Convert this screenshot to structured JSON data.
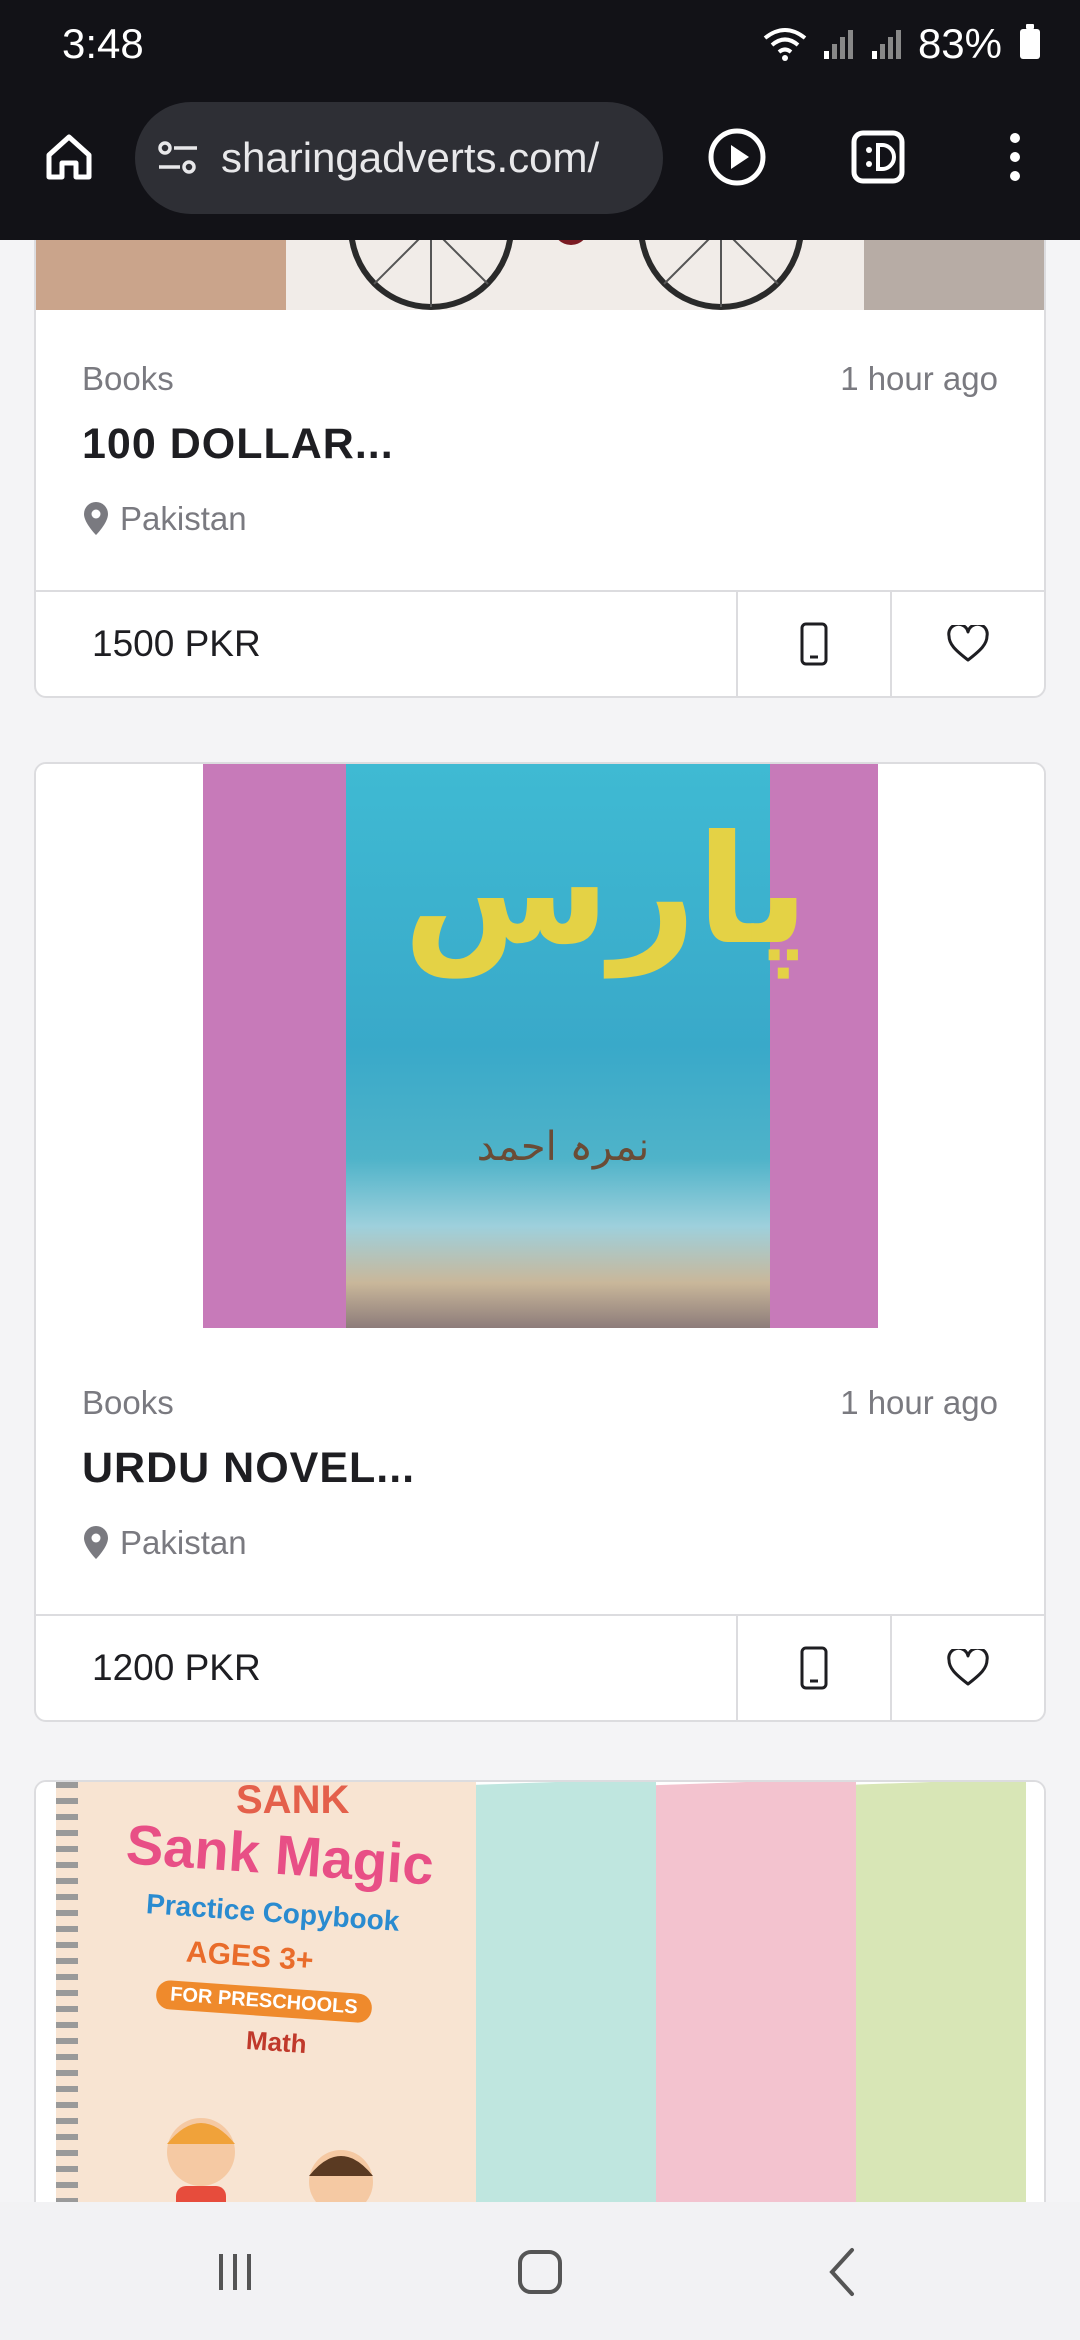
{
  "status_bar": {
    "time": "3:48",
    "battery": "83%"
  },
  "browser": {
    "url": "sharingadverts.com/"
  },
  "listings": [
    {
      "category": "Books",
      "time": "1 hour ago",
      "title": "100 DOLLAR...",
      "location": "Pakistan",
      "price": "1500 PKR"
    },
    {
      "category": "Books",
      "time": "1 hour ago",
      "title": "URDU NOVEL...",
      "location": "Pakistan",
      "price": "1200 PKR",
      "image": {
        "title_text": "پارس",
        "author_text": "نمرہ احمد"
      }
    },
    {
      "image": {
        "brand_text": "SANK",
        "title_text": "Sank Magic",
        "subtitle_text": "Practice Copybook",
        "ages_text": "AGES 3+",
        "band_text": "FOR PRESCHOOLS",
        "subject_text": "Math"
      }
    }
  ],
  "colors": {
    "topbar": "#121217",
    "card_border": "#dcdcdf",
    "muted_text": "#7a7a80"
  }
}
